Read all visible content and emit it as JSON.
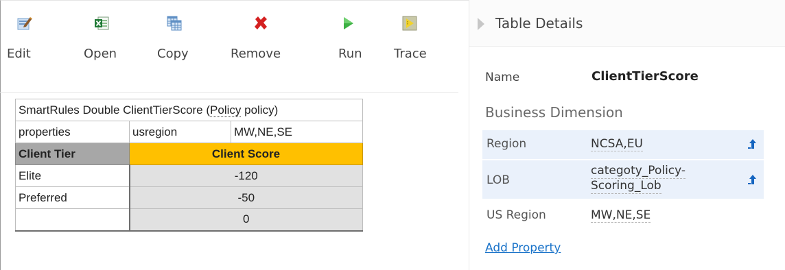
{
  "toolbar": {
    "edit_label": "Edit",
    "open_label": "Open",
    "copy_label": "Copy",
    "remove_label": "Remove",
    "run_label": "Run",
    "trace_label": "Trace"
  },
  "table": {
    "title_prefix": "SmartRules Double ClientTierScore (",
    "title_policy": "Policy",
    "title_suffix": " policy)",
    "properties_label": "properties",
    "property_name": "usregion",
    "property_value": "MW,NE,SE",
    "header_tier": "Client Tier",
    "header_score": "Client Score",
    "rows": [
      {
        "tier": "Elite",
        "score": "-120"
      },
      {
        "tier": "Preferred",
        "score": "-50"
      },
      {
        "tier": "",
        "score": "0"
      }
    ]
  },
  "details": {
    "title": "Table Details",
    "name_label": "Name",
    "name_value": "ClientTierScore",
    "business_dimension_title": "Business Dimension",
    "properties": [
      {
        "key": "Region",
        "value": "NCSA,EU"
      },
      {
        "key": "LOB",
        "value_line1": "categoty_Policy-",
        "value_line2": "Scoring_Lob"
      },
      {
        "key": "US Region",
        "value": "MW,NE,SE"
      }
    ],
    "add_property_label": "Add Property"
  },
  "colors": {
    "score_header": "#ffc000",
    "tier_header": "#a7a7a7",
    "value_cell": "#e1e1e1",
    "highlight_row": "#eaf1fb",
    "link": "#1a73c9"
  }
}
